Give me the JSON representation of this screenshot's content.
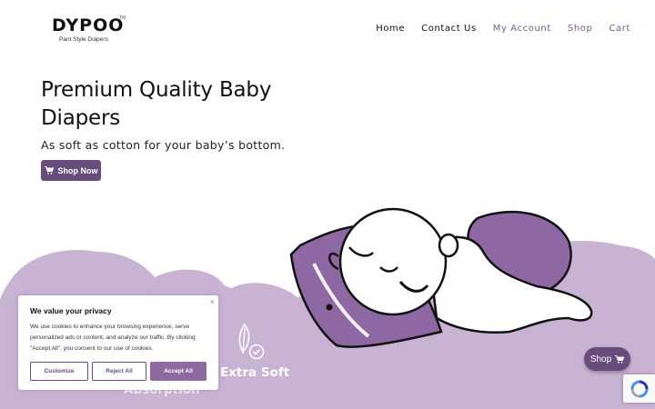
{
  "brand": {
    "name": "DYPOO",
    "trademark": "TM",
    "tagline": "Pant Style Diapers"
  },
  "nav": {
    "items": [
      {
        "label": "Home"
      },
      {
        "label": "Contact Us"
      },
      {
        "label": "My Account"
      },
      {
        "label": "Shop"
      },
      {
        "label": "Cart"
      }
    ]
  },
  "hero": {
    "title": "Premium Quality Baby Diapers",
    "subtitle": "As soft as cotton for your baby’s bottom.",
    "cta_label": "Shop Now",
    "cta_icon": "cart-icon"
  },
  "features": [
    {
      "label": "Extra Soft",
      "icon": "feather-check-icon"
    },
    {
      "label": "Absorption"
    }
  ],
  "cookie_banner": {
    "title": "We value your privacy",
    "body": "We use cookies to enhance your browsing experience, serve personalized ads or content, and analyze our traffic. By clicking \"Accept All\", you consent to our use of cookies.",
    "close": "×",
    "customize_label": "Customize",
    "reject_label": "Reject All",
    "accept_label": "Accept All"
  },
  "floating_shop": {
    "label": "Shop",
    "icon": "cart-icon"
  },
  "colors": {
    "accent": "#6a4c7c",
    "accent_light": "#8e6aa0",
    "cloud": "#c9b3d3",
    "cloud_dark": "#bfa5cc",
    "diaper": "#8d68a3",
    "nav_purple": "#7a5b8c"
  }
}
